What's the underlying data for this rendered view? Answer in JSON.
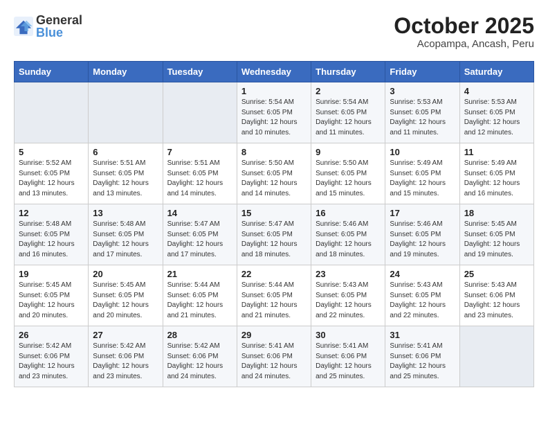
{
  "header": {
    "logo_general": "General",
    "logo_blue": "Blue",
    "title": "October 2025",
    "subtitle": "Acopampa, Ancash, Peru"
  },
  "days_of_week": [
    "Sunday",
    "Monday",
    "Tuesday",
    "Wednesday",
    "Thursday",
    "Friday",
    "Saturday"
  ],
  "weeks": [
    [
      {
        "day": "",
        "info": ""
      },
      {
        "day": "",
        "info": ""
      },
      {
        "day": "",
        "info": ""
      },
      {
        "day": "1",
        "info": "Sunrise: 5:54 AM\nSunset: 6:05 PM\nDaylight: 12 hours\nand 10 minutes."
      },
      {
        "day": "2",
        "info": "Sunrise: 5:54 AM\nSunset: 6:05 PM\nDaylight: 12 hours\nand 11 minutes."
      },
      {
        "day": "3",
        "info": "Sunrise: 5:53 AM\nSunset: 6:05 PM\nDaylight: 12 hours\nand 11 minutes."
      },
      {
        "day": "4",
        "info": "Sunrise: 5:53 AM\nSunset: 6:05 PM\nDaylight: 12 hours\nand 12 minutes."
      }
    ],
    [
      {
        "day": "5",
        "info": "Sunrise: 5:52 AM\nSunset: 6:05 PM\nDaylight: 12 hours\nand 13 minutes."
      },
      {
        "day": "6",
        "info": "Sunrise: 5:51 AM\nSunset: 6:05 PM\nDaylight: 12 hours\nand 13 minutes."
      },
      {
        "day": "7",
        "info": "Sunrise: 5:51 AM\nSunset: 6:05 PM\nDaylight: 12 hours\nand 14 minutes."
      },
      {
        "day": "8",
        "info": "Sunrise: 5:50 AM\nSunset: 6:05 PM\nDaylight: 12 hours\nand 14 minutes."
      },
      {
        "day": "9",
        "info": "Sunrise: 5:50 AM\nSunset: 6:05 PM\nDaylight: 12 hours\nand 15 minutes."
      },
      {
        "day": "10",
        "info": "Sunrise: 5:49 AM\nSunset: 6:05 PM\nDaylight: 12 hours\nand 15 minutes."
      },
      {
        "day": "11",
        "info": "Sunrise: 5:49 AM\nSunset: 6:05 PM\nDaylight: 12 hours\nand 16 minutes."
      }
    ],
    [
      {
        "day": "12",
        "info": "Sunrise: 5:48 AM\nSunset: 6:05 PM\nDaylight: 12 hours\nand 16 minutes."
      },
      {
        "day": "13",
        "info": "Sunrise: 5:48 AM\nSunset: 6:05 PM\nDaylight: 12 hours\nand 17 minutes."
      },
      {
        "day": "14",
        "info": "Sunrise: 5:47 AM\nSunset: 6:05 PM\nDaylight: 12 hours\nand 17 minutes."
      },
      {
        "day": "15",
        "info": "Sunrise: 5:47 AM\nSunset: 6:05 PM\nDaylight: 12 hours\nand 18 minutes."
      },
      {
        "day": "16",
        "info": "Sunrise: 5:46 AM\nSunset: 6:05 PM\nDaylight: 12 hours\nand 18 minutes."
      },
      {
        "day": "17",
        "info": "Sunrise: 5:46 AM\nSunset: 6:05 PM\nDaylight: 12 hours\nand 19 minutes."
      },
      {
        "day": "18",
        "info": "Sunrise: 5:45 AM\nSunset: 6:05 PM\nDaylight: 12 hours\nand 19 minutes."
      }
    ],
    [
      {
        "day": "19",
        "info": "Sunrise: 5:45 AM\nSunset: 6:05 PM\nDaylight: 12 hours\nand 20 minutes."
      },
      {
        "day": "20",
        "info": "Sunrise: 5:45 AM\nSunset: 6:05 PM\nDaylight: 12 hours\nand 20 minutes."
      },
      {
        "day": "21",
        "info": "Sunrise: 5:44 AM\nSunset: 6:05 PM\nDaylight: 12 hours\nand 21 minutes."
      },
      {
        "day": "22",
        "info": "Sunrise: 5:44 AM\nSunset: 6:05 PM\nDaylight: 12 hours\nand 21 minutes."
      },
      {
        "day": "23",
        "info": "Sunrise: 5:43 AM\nSunset: 6:05 PM\nDaylight: 12 hours\nand 22 minutes."
      },
      {
        "day": "24",
        "info": "Sunrise: 5:43 AM\nSunset: 6:05 PM\nDaylight: 12 hours\nand 22 minutes."
      },
      {
        "day": "25",
        "info": "Sunrise: 5:43 AM\nSunset: 6:06 PM\nDaylight: 12 hours\nand 23 minutes."
      }
    ],
    [
      {
        "day": "26",
        "info": "Sunrise: 5:42 AM\nSunset: 6:06 PM\nDaylight: 12 hours\nand 23 minutes."
      },
      {
        "day": "27",
        "info": "Sunrise: 5:42 AM\nSunset: 6:06 PM\nDaylight: 12 hours\nand 23 minutes."
      },
      {
        "day": "28",
        "info": "Sunrise: 5:42 AM\nSunset: 6:06 PM\nDaylight: 12 hours\nand 24 minutes."
      },
      {
        "day": "29",
        "info": "Sunrise: 5:41 AM\nSunset: 6:06 PM\nDaylight: 12 hours\nand 24 minutes."
      },
      {
        "day": "30",
        "info": "Sunrise: 5:41 AM\nSunset: 6:06 PM\nDaylight: 12 hours\nand 25 minutes."
      },
      {
        "day": "31",
        "info": "Sunrise: 5:41 AM\nSunset: 6:06 PM\nDaylight: 12 hours\nand 25 minutes."
      },
      {
        "day": "",
        "info": ""
      }
    ]
  ]
}
